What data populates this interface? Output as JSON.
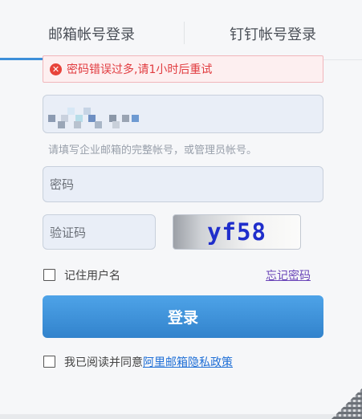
{
  "tabs": [
    {
      "label": "邮箱帐号登录",
      "active": true
    },
    {
      "label": "钉钉帐号登录",
      "active": false
    }
  ],
  "error": {
    "icon": "close-icon",
    "message": "密码错误过多,请1小时后重试"
  },
  "account": {
    "hint": "请填写企业邮箱的完整帐号，或管理员帐号。"
  },
  "password": {
    "placeholder": "密码"
  },
  "captcha": {
    "placeholder": "验证码",
    "image_text": "yf58"
  },
  "remember": {
    "label": "记住用户名"
  },
  "forgot": {
    "label": "忘记密码"
  },
  "login": {
    "label": "登录"
  },
  "agree": {
    "prefix": "我已阅读并同意",
    "link": "阿里邮箱隐私政策"
  },
  "colors": {
    "accent": "#3d8fd9",
    "error": "#e13b3f",
    "link": "#1f6fd6",
    "forgot_link": "#6a45b8"
  }
}
